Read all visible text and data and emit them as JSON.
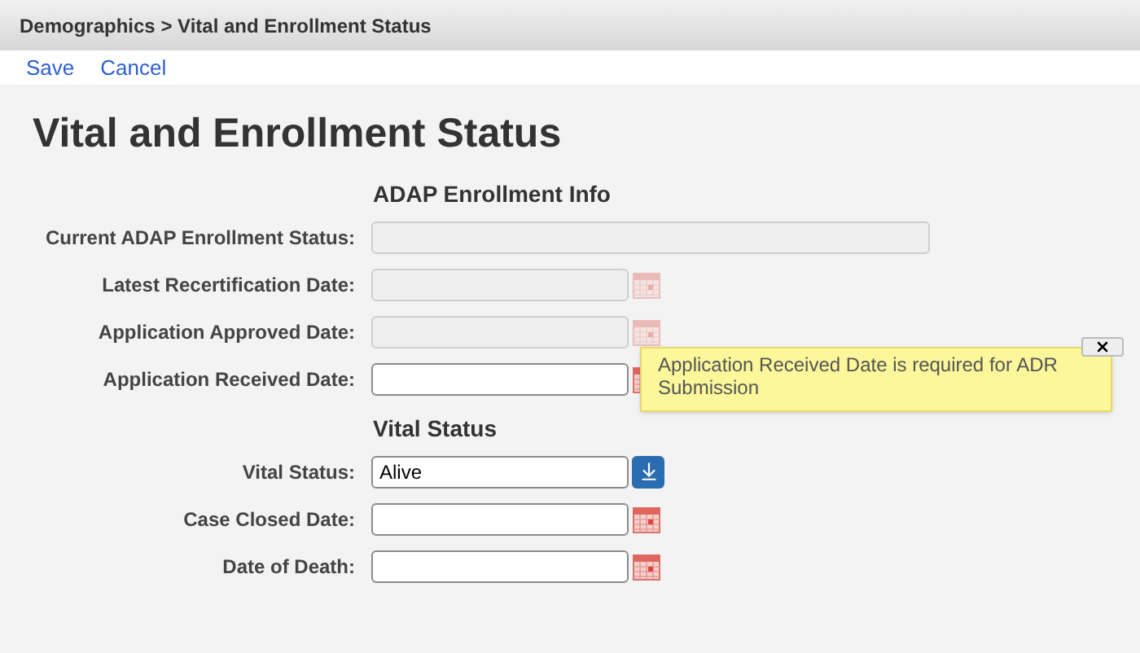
{
  "breadcrumb": "Demographics > Vital and Enrollment Status",
  "toolbar": [
    "Save",
    "Cancel"
  ],
  "page_title": "Vital and Enrollment Status",
  "sections": [
    {
      "heading": "ADAP Enrollment Info",
      "fields": [
        {
          "label": "Current ADAP Enrollment Status:",
          "kind": "text",
          "disabled": true
        },
        {
          "label": "Latest Recertification Date:",
          "kind": "date",
          "disabled": true
        },
        {
          "label": "Application Approved Date:",
          "kind": "date",
          "disabled": true
        },
        {
          "label": "Application Received Date:",
          "kind": "date",
          "disabled": false
        }
      ]
    },
    {
      "heading": "Vital Status",
      "fields": [
        {
          "label": "Vital Status:",
          "kind": "select",
          "disabled": false,
          "value": "Alive"
        },
        {
          "label": "Case Closed Date:",
          "kind": "date",
          "disabled": false
        },
        {
          "label": "Date of Death:",
          "kind": "date",
          "disabled": false
        }
      ]
    }
  ],
  "tooltip": {
    "text": "Application Received Date is required for ADR Submission"
  }
}
